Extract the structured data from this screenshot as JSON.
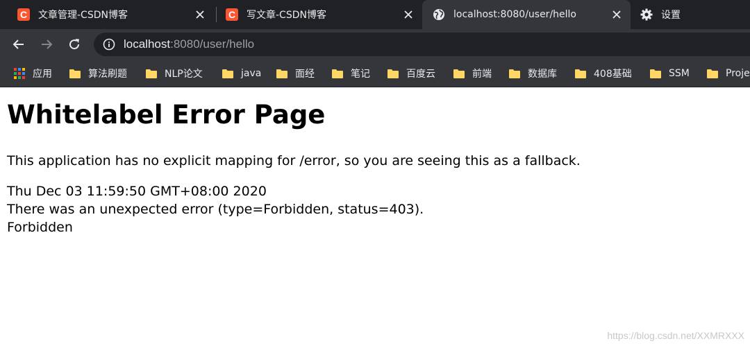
{
  "tabs": [
    {
      "title": "文章管理-CSDN博客",
      "favicon_letter": "C",
      "active": false
    },
    {
      "title": "写文章-CSDN博客",
      "favicon_letter": "C",
      "active": false
    },
    {
      "title": "localhost:8080/user/hello",
      "active": true
    },
    {
      "title": "设置",
      "active": false
    }
  ],
  "address_bar": {
    "host": "localhost",
    "rest": ":8080/user/hello"
  },
  "bookmarks": {
    "apps_label": "应用",
    "items": [
      "算法刷题",
      "NLP论文",
      "java",
      "面经",
      "笔记",
      "百度云",
      "前端",
      "数据库",
      "408基础",
      "SSM",
      "Proje"
    ]
  },
  "page": {
    "title": "Whitelabel Error Page",
    "message": "This application has no explicit mapping for /error, so you are seeing this as a fallback.",
    "timestamp": "Thu Dec 03 11:59:50 GMT+08:00 2020",
    "error_line": "There was an unexpected error (type=Forbidden, status=403).",
    "error_detail": "Forbidden"
  },
  "watermark": "https://blog.csdn.net/XXMRXXX",
  "colors": {
    "tabstrip_bg": "#202124",
    "toolbar_bg": "#35363a",
    "csdn_brand": "#fc5531",
    "folder": "#fdd663"
  }
}
